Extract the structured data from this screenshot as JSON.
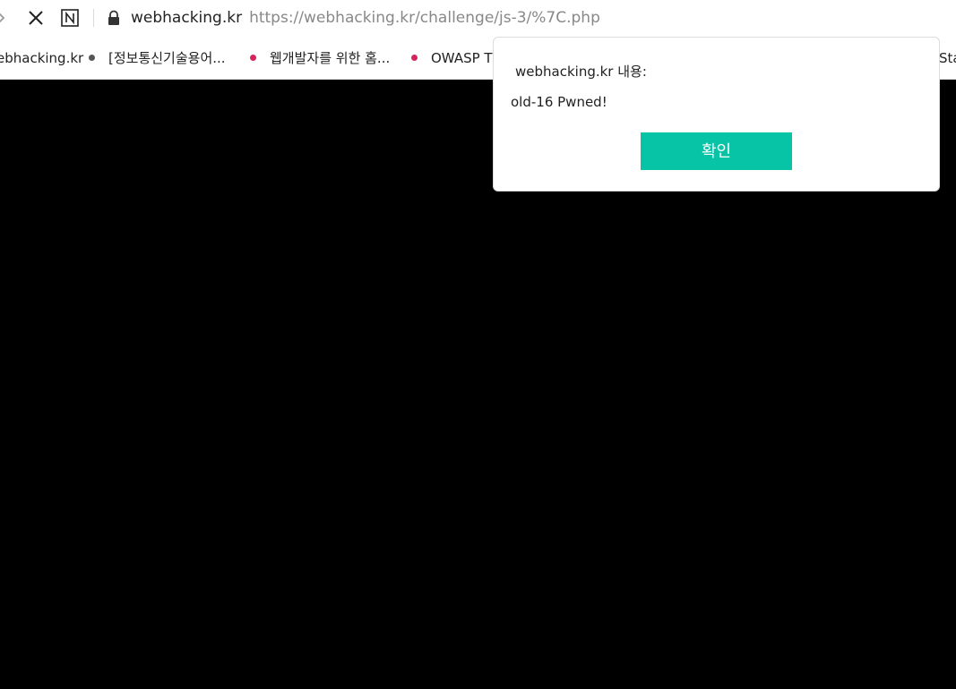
{
  "browser": {
    "address_bar": {
      "host": "webhacking.kr",
      "url": "https://webhacking.kr/challenge/js-3/%7C.php"
    },
    "icons": {
      "forward": "forward-chevron-icon",
      "stop": "stop-icon",
      "naver": "naver-n-icon",
      "lock": "lock-icon"
    }
  },
  "bookmarks": {
    "items": [
      {
        "label": "ebhacking.kr",
        "dot_color": null
      },
      {
        "label": "[정보통신기술용어...",
        "dot_color": "#555555"
      },
      {
        "label": "웹개발자를 위한 홈...",
        "dot_color": "#d6245a"
      },
      {
        "label": "OWASP TO",
        "dot_color": "#d6245a"
      },
      {
        "label": "Sta",
        "dot_color": null
      }
    ]
  },
  "dialog": {
    "title": "webhacking.kr 내용:",
    "message": "old-16 Pwned!",
    "confirm_label": "확인",
    "confirm_color": "#08c4a6"
  },
  "page": {
    "background": "#000000"
  }
}
